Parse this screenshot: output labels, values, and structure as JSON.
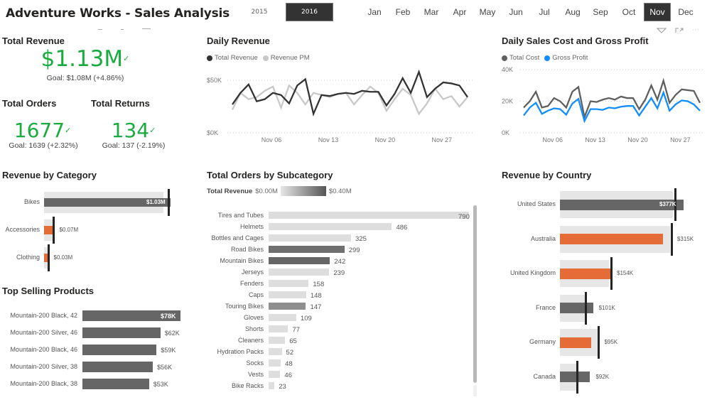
{
  "header": {
    "title": "Adventure Works - Sales Analysis",
    "years": [
      {
        "label": "2015",
        "selected": false
      },
      {
        "label": "2016",
        "selected": true
      }
    ],
    "months": [
      {
        "label": "Jan",
        "selected": false
      },
      {
        "label": "Feb",
        "selected": false
      },
      {
        "label": "Mar",
        "selected": false
      },
      {
        "label": "Apr",
        "selected": false
      },
      {
        "label": "May",
        "selected": false
      },
      {
        "label": "Jun",
        "selected": false
      },
      {
        "label": "Jul",
        "selected": false
      },
      {
        "label": "Aug",
        "selected": false
      },
      {
        "label": "Sep",
        "selected": false
      },
      {
        "label": "Oct",
        "selected": false
      },
      {
        "label": "Nov",
        "selected": true
      },
      {
        "label": "Dec",
        "selected": false
      }
    ]
  },
  "visual_header_icons": [
    "filter-icon",
    "focus-mode-icon",
    "more-options-icon"
  ],
  "kpis": {
    "revenue": {
      "title": "Total Revenue",
      "value": "$1.13M",
      "check": "✓",
      "goal": "Goal: $1.08M (+4.86%)"
    },
    "orders": {
      "title": "Total Orders",
      "value": "1677",
      "check": "✓",
      "goal": "Goal: 1639 (+2.32%)"
    },
    "returns": {
      "title": "Total Returns",
      "value": "134",
      "check": "✓",
      "goal": "Goal: 137 (-2.19%)"
    }
  },
  "colors": {
    "kpi_green": "#1aab40",
    "dark_bar": "#666666",
    "orange": "#e66c37",
    "light_bg": "#e6e6e6",
    "blue": "#118dff",
    "line_dark": "#333333",
    "line_light": "#c8c8c8"
  },
  "chart_data": [
    {
      "id": "daily_revenue",
      "type": "line",
      "title": "Daily Revenue",
      "legend": [
        "Total Revenue",
        "Revenue PM"
      ],
      "yticks": [
        "$0K",
        "$50K"
      ],
      "ylim": [
        0,
        60000
      ],
      "xticks": [
        "Nov 06",
        "Nov 13",
        "Nov 20",
        "Nov 27"
      ],
      "x": [
        1,
        2,
        3,
        4,
        5,
        6,
        7,
        8,
        9,
        10,
        11,
        12,
        13,
        14,
        15,
        16,
        17,
        18,
        19,
        20,
        21,
        22,
        23,
        24,
        25,
        26,
        27,
        28,
        29,
        30
      ],
      "series": [
        {
          "name": "Total Revenue",
          "color": "#333333",
          "values": [
            27000,
            38000,
            46000,
            30000,
            32000,
            38000,
            36000,
            28000,
            45000,
            51000,
            18000,
            36000,
            35000,
            37000,
            38000,
            37000,
            40000,
            39000,
            39000,
            26000,
            37000,
            52000,
            38000,
            58000,
            34000,
            42000,
            48000,
            47000,
            45000,
            34000
          ]
        },
        {
          "name": "Revenue PM",
          "color": "#c8c8c8",
          "values": [
            22000,
            38000,
            32000,
            34000,
            40000,
            44000,
            24000,
            45000,
            38000,
            27000,
            38000,
            36000,
            34000,
            37000,
            38000,
            27000,
            36000,
            44000,
            38000,
            21000,
            32000,
            42000,
            36000,
            18000,
            28000,
            42000,
            32000,
            35000,
            25000,
            34000
          ]
        }
      ]
    },
    {
      "id": "daily_cost_profit",
      "type": "line",
      "title": "Daily Sales Cost and Gross Profit",
      "legend": [
        "Total Cost",
        "Gross Profit"
      ],
      "yticks": [
        "0K",
        "20K",
        "40K"
      ],
      "ylim": [
        0,
        40000
      ],
      "xticks": [
        "Nov 06",
        "Nov 13",
        "Nov 20",
        "Nov 27"
      ],
      "x": [
        1,
        2,
        3,
        4,
        5,
        6,
        7,
        8,
        9,
        10,
        11,
        12,
        13,
        14,
        15,
        16,
        17,
        18,
        19,
        20,
        21,
        22,
        23,
        24,
        25,
        26,
        27,
        28,
        29,
        30
      ],
      "series": [
        {
          "name": "Total Cost",
          "color": "#5f5f5f",
          "values": [
            16000,
            20000,
            26000,
            16000,
            17000,
            22000,
            20000,
            16000,
            26000,
            29000,
            10000,
            20000,
            19500,
            21000,
            22000,
            21000,
            23000,
            22000,
            22000,
            15000,
            21000,
            30000,
            21000,
            33000,
            19000,
            24000,
            27500,
            27000,
            26500,
            19000
          ]
        },
        {
          "name": "Gross Profit",
          "color": "#118dff",
          "values": [
            11000,
            16000,
            19000,
            12000,
            14000,
            15500,
            15000,
            11500,
            18500,
            21500,
            7500,
            15000,
            15000,
            14500,
            16000,
            15500,
            16500,
            17000,
            17000,
            11000,
            16500,
            22000,
            15500,
            25500,
            14000,
            18000,
            20500,
            20000,
            18000,
            14000
          ]
        }
      ]
    },
    {
      "id": "revenue_by_category",
      "type": "bar",
      "title": "Revenue by Category",
      "categories": [
        "Bikes",
        "Accessories",
        "Clothing"
      ],
      "values": [
        1.03,
        0.07,
        0.03
      ],
      "labels": [
        "$1.03M",
        "$0.07M",
        "$0.03M"
      ],
      "targets": [
        1.015,
        0.078,
        0.032
      ],
      "background": [
        0.97,
        0.078,
        0.032
      ],
      "bar_colors": [
        "#666666",
        "#e66c37",
        "#e66c37"
      ],
      "unit": "$M"
    },
    {
      "id": "top_selling_products",
      "type": "bar",
      "title": "Top Selling Products",
      "categories": [
        "Mountain-200 Black, 42",
        "Mountain-200 Silver, 46",
        "Mountain-200 Black, 46",
        "Mountain-200 Silver, 38",
        "Mountain-200 Black, 38"
      ],
      "values": [
        78,
        62,
        59,
        56,
        53
      ],
      "labels": [
        "$78K",
        "$62K",
        "$59K",
        "$56K",
        "$53K"
      ],
      "unit": "$K"
    },
    {
      "id": "orders_by_subcategory",
      "type": "bar",
      "title": "Total Orders by Subcategory",
      "color_legend": {
        "title": "Total Revenue",
        "min_label": "$0.00M",
        "max_label": "$0.40M"
      },
      "categories": [
        "Tires and Tubes",
        "Helmets",
        "Bottles and Cages",
        "Road Bikes",
        "Mountain Bikes",
        "Jerseys",
        "Fenders",
        "Caps",
        "Touring Bikes",
        "Gloves",
        "Shorts",
        "Cleaners",
        "Hydration Packs",
        "Socks",
        "Vests",
        "Bike Racks"
      ],
      "values": [
        790,
        486,
        325,
        299,
        242,
        239,
        158,
        148,
        147,
        109,
        77,
        65,
        52,
        48,
        46,
        23
      ],
      "bar_colors": [
        "#dddddd",
        "#dedede",
        "#dedede",
        "#707070",
        "#666666",
        "#dedede",
        "#dedede",
        "#dedede",
        "#8e8e8e",
        "#dedede",
        "#dedede",
        "#dedede",
        "#dedede",
        "#dedede",
        "#dedede",
        "#dedede"
      ],
      "xlim": [
        0,
        790
      ]
    },
    {
      "id": "revenue_by_country",
      "type": "bar",
      "title": "Revenue by Country",
      "categories": [
        "United States",
        "Australia",
        "United Kingdom",
        "France",
        "Germany",
        "Canada"
      ],
      "values": [
        377,
        315,
        154,
        101,
        95,
        92
      ],
      "labels": [
        "$377K",
        "$315K",
        "$154K",
        "$101K",
        "$95K",
        "$92K"
      ],
      "targets": [
        352,
        340,
        156,
        79,
        118,
        51
      ],
      "background": [
        344,
        335,
        149,
        79,
        114,
        51
      ],
      "bar_colors": [
        "#666666",
        "#e66c37",
        "#e66c37",
        "#666666",
        "#e66c37",
        "#666666"
      ],
      "unit": "$K"
    }
  ]
}
